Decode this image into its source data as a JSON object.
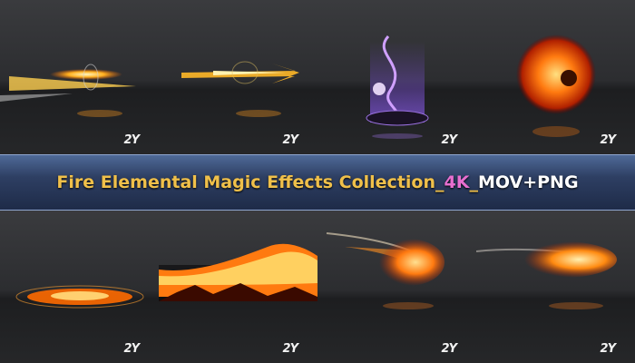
{
  "banner": {
    "title_main": "Fire Elemental Magic Effects Collection",
    "sep1": "_",
    "title_hl": "4K",
    "sep2": "_",
    "title_fmt": "MOV+PNG"
  },
  "watermark": "2Y",
  "tiles_top": [
    {
      "name": "fire-bolt-effect"
    },
    {
      "name": "fire-arrow-effect"
    },
    {
      "name": "purple-skull-pillar-effect"
    },
    {
      "name": "fireball-explosion-effect"
    }
  ],
  "tiles_bottom": [
    {
      "name": "ground-fire-circle-effect"
    },
    {
      "name": "fire-wave-effect"
    },
    {
      "name": "fire-comet-effect"
    },
    {
      "name": "fire-streak-effect"
    }
  ],
  "colors": {
    "banner_text": "#f0c04a",
    "banner_highlight": "#e86fd0",
    "banner_format": "#ffffff",
    "banner_bg": "#2e3f63"
  }
}
